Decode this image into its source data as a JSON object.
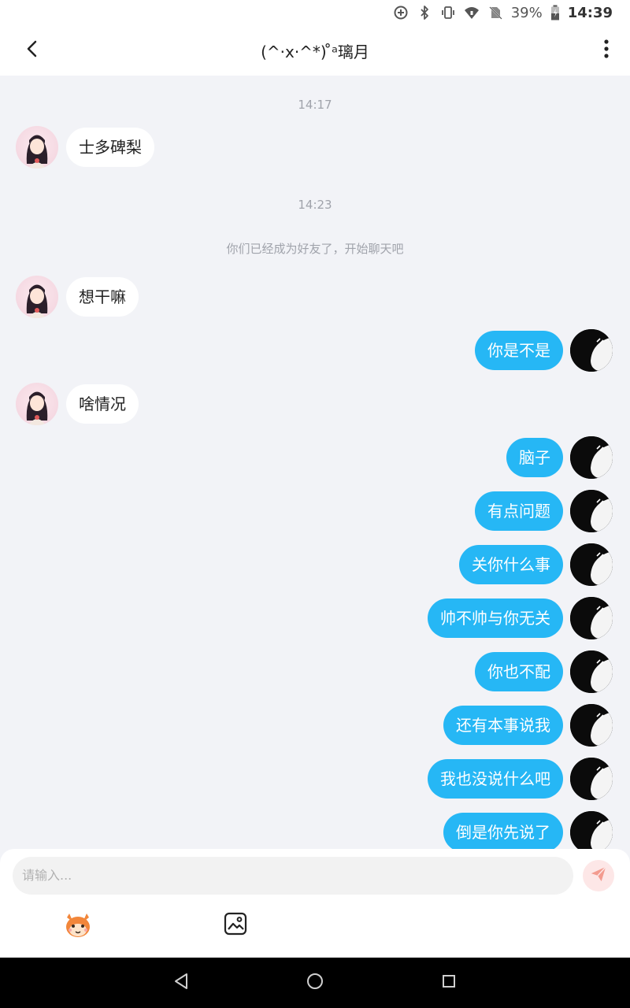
{
  "status_bar": {
    "battery": "39%",
    "time": "14:39",
    "icons": [
      "data-saver-icon",
      "bluetooth-icon",
      "vibrate-icon",
      "wifi-icon",
      "no-sim-icon",
      "battery-icon"
    ]
  },
  "header": {
    "title": "(^·x·^*) ̊ᵃ璃月",
    "back_icon": "chevron-left-icon",
    "more_icon": "more-vertical-icon"
  },
  "chat": {
    "time_labels": [
      "14:17",
      "14:23"
    ],
    "system_message": "你们已经成为好友了，开始聊天吧",
    "messages": [
      {
        "side": "left",
        "text": "士多碑梨"
      },
      {
        "side": "left",
        "text": "想干嘛"
      },
      {
        "side": "right",
        "text": "你是不是"
      },
      {
        "side": "left",
        "text": "啥情况"
      },
      {
        "side": "right",
        "text": "脑子"
      },
      {
        "side": "right",
        "text": "有点问题"
      },
      {
        "side": "right",
        "text": "关你什么事"
      },
      {
        "side": "right",
        "text": "帅不帅与你无关"
      },
      {
        "side": "right",
        "text": "你也不配"
      },
      {
        "side": "right",
        "text": "还有本事说我"
      },
      {
        "side": "right",
        "text": "我也没说什么吧"
      },
      {
        "side": "right",
        "text": "倒是你先说了"
      }
    ]
  },
  "input": {
    "placeholder": "请输入...",
    "send_icon": "send-icon",
    "tools": [
      "sticker-icon",
      "image-icon"
    ]
  },
  "nav": {
    "icons": [
      "nav-back-icon",
      "nav-home-icon",
      "nav-recents-icon"
    ]
  },
  "colors": {
    "accent": "#26b7f5",
    "chat_bg": "#f2f3f7",
    "send_bg": "#fde7e7",
    "send_icon": "#f39b8f"
  }
}
